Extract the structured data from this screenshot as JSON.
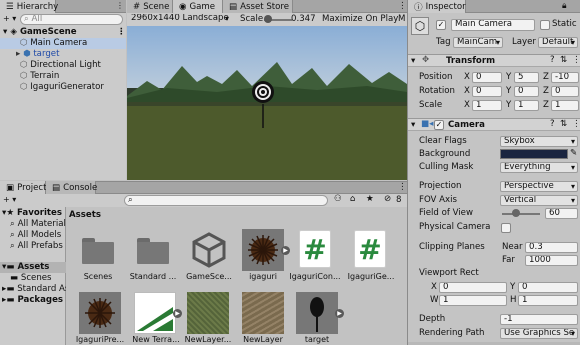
{
  "hierarchy": {
    "tab": "Hierarchy",
    "add": "+ ▾",
    "search_placeholder": "All",
    "scene": "GameScene",
    "items": [
      {
        "label": "Main Camera"
      },
      {
        "label": "target"
      },
      {
        "label": "Directional Light"
      },
      {
        "label": "Terrain"
      },
      {
        "label": "IgaguriGenerator"
      }
    ]
  },
  "game_tabs": {
    "scene": "Scene",
    "game": "Game",
    "asset_store": "Asset Store"
  },
  "game_toolbar": {
    "resolution": "2960x1440 Landscape (2",
    "scale_label": "Scale",
    "scale_value": "0.347",
    "maximize": "Maximize On Play",
    "mute": "M"
  },
  "project": {
    "tab_project": "Project",
    "tab_console": "Console",
    "add": "+ ▾",
    "counter": "8",
    "favorites": "Favorites",
    "fav_items": [
      "All Materials",
      "All Models",
      "All Prefabs"
    ],
    "assets_root": "Assets",
    "asset_items": [
      "Scenes",
      "Standard As"
    ],
    "packages": "Packages",
    "breadcrumb": "Assets",
    "assets": [
      {
        "name": "Scenes",
        "kind": "folder"
      },
      {
        "name": "Standard ...",
        "kind": "folder"
      },
      {
        "name": "GameSce...",
        "kind": "unity"
      },
      {
        "name": "igaguri",
        "kind": "chestnut"
      },
      {
        "name": "IgaguriCon...",
        "kind": "script"
      },
      {
        "name": "IgaguriGe...",
        "kind": "script"
      },
      {
        "name": "IgaguriPre...",
        "kind": "chestnut"
      },
      {
        "name": "New Terra...",
        "kind": "terrain"
      },
      {
        "name": "NewLayer...",
        "kind": "texture"
      },
      {
        "name": "NewLayer",
        "kind": "texture"
      },
      {
        "name": "target",
        "kind": "target"
      }
    ]
  },
  "inspector": {
    "tab": "Inspector",
    "object_name": "Main Camera",
    "static_label": "Static",
    "tag_label": "Tag",
    "tag_value": "MainCam",
    "layer_label": "Layer",
    "layer_value": "Default",
    "transform": {
      "title": "Transform",
      "rows": [
        {
          "label": "Position",
          "x": "0",
          "y": "5",
          "z": "-10"
        },
        {
          "label": "Rotation",
          "x": "0",
          "y": "0",
          "z": "0"
        },
        {
          "label": "Scale",
          "x": "1",
          "y": "1",
          "z": "1"
        }
      ]
    },
    "camera": {
      "title": "Camera",
      "clear_flags_label": "Clear Flags",
      "clear_flags": "Skybox",
      "background_label": "Background",
      "background_color": "#1a2540",
      "culling_mask_label": "Culling Mask",
      "culling_mask": "Everything",
      "projection_label": "Projection",
      "projection": "Perspective",
      "fov_axis_label": "FOV Axis",
      "fov_axis": "Vertical",
      "fov_label": "Field of View",
      "fov_value": "60",
      "physical_label": "Physical Camera",
      "clipping_label": "Clipping Planes",
      "near_label": "Near",
      "near": "0.3",
      "far_label": "Far",
      "far": "1000",
      "viewport_label": "Viewport Rect",
      "vx": "0",
      "vy": "0",
      "vw": "1",
      "vh": "1",
      "depth_label": "Depth",
      "depth": "-1",
      "rendering_label": "Rendering Path",
      "rendering": "Use Graphics Se"
    }
  },
  "colors": {
    "panel": "#c2c2c2",
    "accent": "#3a72b0",
    "selection": "#b9cbe4"
  }
}
